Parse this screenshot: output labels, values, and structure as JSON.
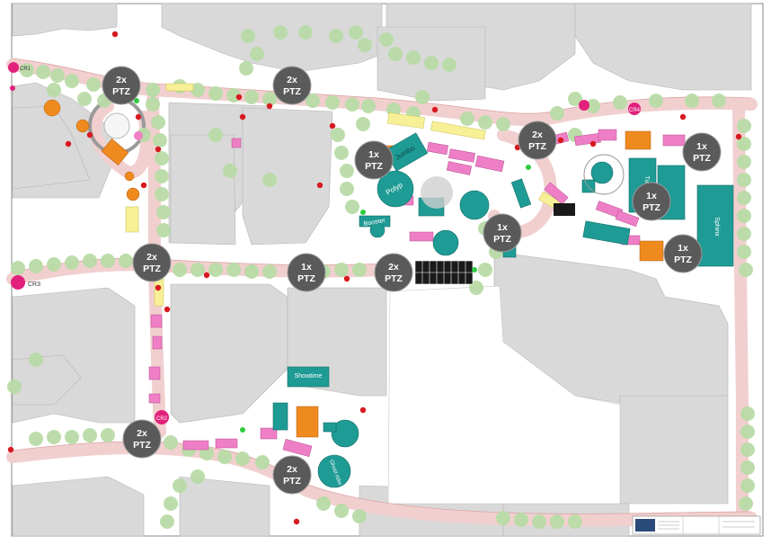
{
  "map": {
    "colors": {
      "background": "#ffffff",
      "building": "#d9d9d9",
      "building_edge": "#b5b5b5",
      "street_route": "#f2cfcf",
      "route_edge": "#d9a3a3",
      "tree": "#b9dca7",
      "attraction_teal": "#1f9b95",
      "attraction_orange": "#ef8a1f",
      "stall_pink": "#ee7fc6",
      "stall_yellow": "#f7f097",
      "ptz_marker": "#5a5a5a",
      "cr_marker": "#e2217c",
      "red_dot": "#d71920"
    },
    "cameras": [
      {
        "count": "2x",
        "type": "PTZ"
      },
      {
        "count": "2x",
        "type": "PTZ"
      },
      {
        "count": "2x",
        "type": "PTZ"
      },
      {
        "count": "1x",
        "type": "PTZ"
      },
      {
        "count": "1x",
        "type": "PTZ"
      },
      {
        "count": "1x",
        "type": "PTZ"
      },
      {
        "count": "2x",
        "type": "PTZ"
      },
      {
        "count": "2x",
        "type": "PTZ"
      },
      {
        "count": "1x",
        "type": "PTZ"
      },
      {
        "count": "1x",
        "type": "PTZ"
      },
      {
        "count": "1x",
        "type": "PTZ"
      },
      {
        "count": "2x",
        "type": "PTZ"
      },
      {
        "count": "2x",
        "type": "PTZ"
      }
    ],
    "cr_markers": [
      "CR3",
      "CR2",
      "CR1",
      "CR4"
    ],
    "ride_labels": [
      "Jumbo",
      "Polyp",
      "Booster",
      "Showtime",
      "Ghost rider",
      "Tunnel",
      "Sphinx"
    ]
  }
}
